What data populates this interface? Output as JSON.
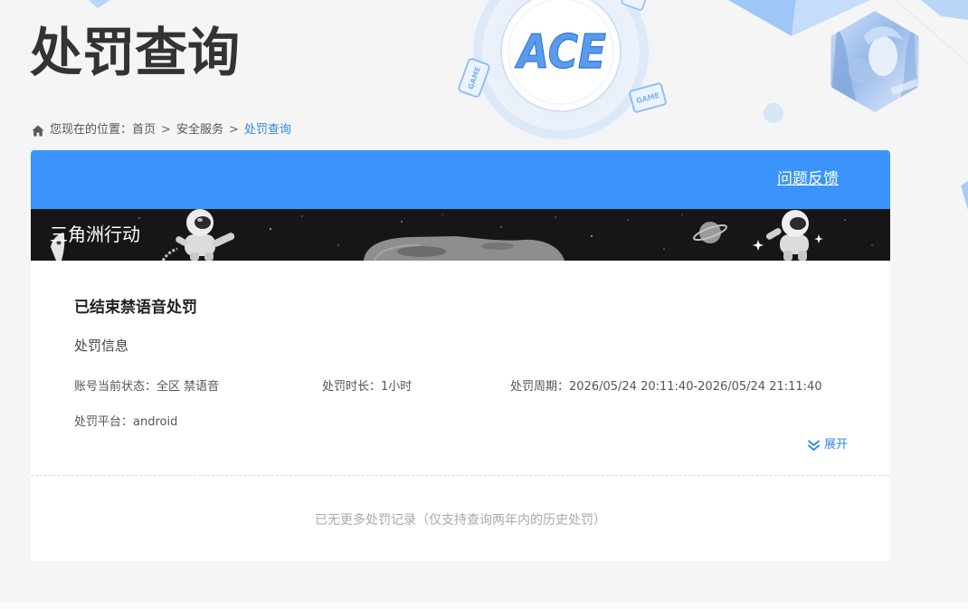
{
  "page": {
    "title": "处罚查询"
  },
  "logo": {
    "text": "ACE"
  },
  "decor": {
    "game_badge": "GAME"
  },
  "breadcrumb": {
    "prefix": "您现在的位置：",
    "separator": ">",
    "items": [
      "首页",
      "安全服务"
    ],
    "current": "处罚查询"
  },
  "header": {
    "feedback_link": "问题反馈"
  },
  "banner": {
    "game_title": "三角洲行动"
  },
  "record": {
    "status_title": "已结束禁语音处罚",
    "section_label": "处罚信息",
    "fields": [
      {
        "label": "账号当前状态：",
        "value": "全区 禁语音"
      },
      {
        "label": "处罚时长：",
        "value": "1小时"
      },
      {
        "label": "处罚周期：",
        "value": "2026/05/24 20:11:40-2026/05/24 21:11:40"
      },
      {
        "label": "处罚平台：",
        "value": "android"
      }
    ],
    "expand_label": "展开"
  },
  "footer_note": "已无更多处罚记录（仅支持查询两年内的历史处罚）",
  "colors": {
    "header_blue": "#3b94fc",
    "link_blue": "#2f86e0",
    "page_bg": "#f5f5f6",
    "banner_bg": "#161616"
  },
  "icons": {
    "breadcrumb": "home-icon",
    "expand": "double-chevron-down-icon"
  }
}
